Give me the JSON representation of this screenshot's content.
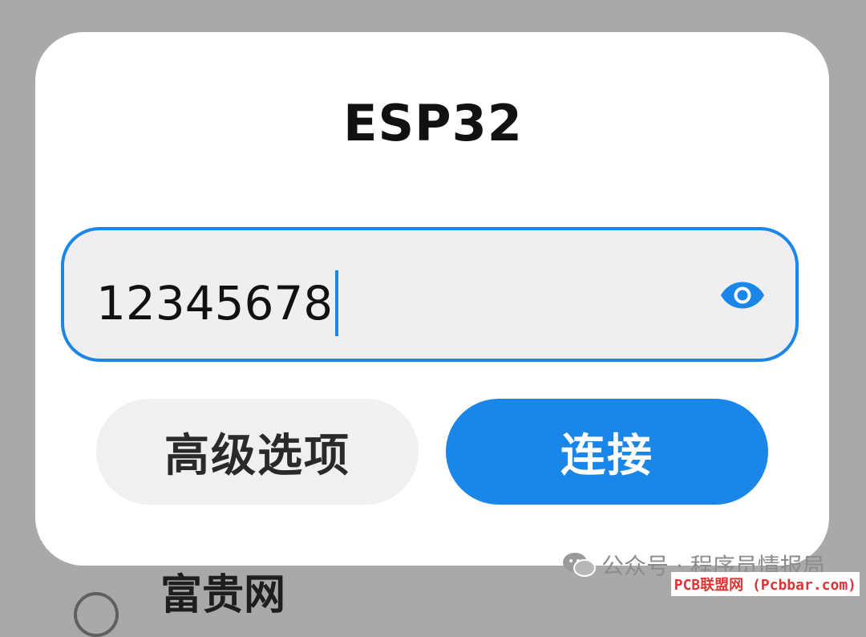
{
  "background": {
    "list_item_label": "富贵网"
  },
  "dialog": {
    "title": "ESP32",
    "password_value": "12345678",
    "advanced_button": "高级选项",
    "connect_button": "连接"
  },
  "watermark": {
    "text": "公众号 · 程序员情报局",
    "brand": "PCB联盟网 (Pcbbar.com)"
  },
  "colors": {
    "accent": "#1a86e8",
    "dialog_bg": "#ffffff",
    "overlay": "#a9a9a9",
    "field_bg": "#efeff1"
  },
  "icons": {
    "visibility": "eye-icon",
    "wechat": "wechat-icon",
    "wifi_list": "wifi-icon"
  }
}
